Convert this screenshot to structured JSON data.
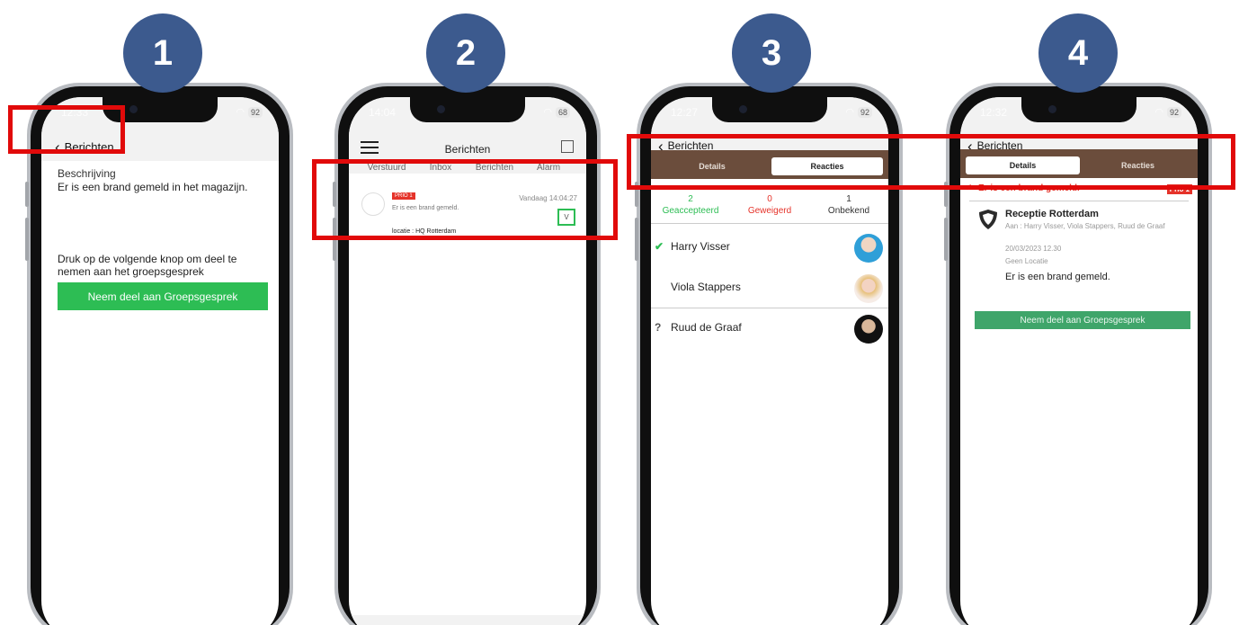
{
  "steps": [
    "1",
    "2",
    "3",
    "4"
  ],
  "colors": {
    "badge": "#3c5a8e",
    "highlight": "#e10a0a",
    "green": "#2dbd54",
    "brown": "#6b4d3c",
    "prio_red": "#e5332a"
  },
  "phone1": {
    "time": "12:33",
    "battery": "92",
    "back_label": "Berichten",
    "description_label": "Beschrijving",
    "description_text": "Er is een brand gemeld in het magazijn.",
    "prompt": "Druk op de volgende knop om deel te nemen aan het groepsgesprek",
    "join_button": "Neem deel aan Groepsgesprek"
  },
  "phone2": {
    "time": "14:04",
    "battery": "68",
    "title": "Berichten",
    "tabs": [
      "Verstuurd",
      "Inbox",
      "Berichten",
      "Alarm"
    ],
    "message": {
      "prio": "PRIO 1",
      "text": "Er is een brand gemeld.",
      "time": "Vandaag 14:04:27",
      "check": "V",
      "location": "locatie : HQ Rotterdam"
    }
  },
  "phone3": {
    "time": "12:27",
    "battery": "92",
    "back_label": "Berichten",
    "tab_details": "Details",
    "tab_reacties": "Reacties",
    "counts": [
      {
        "value": "2",
        "label": "Geaccepteerd",
        "color": "#2dbd54"
      },
      {
        "value": "0",
        "label": "Geweigerd",
        "color": "#e5332a"
      },
      {
        "value": "1",
        "label": "Onbekend",
        "color": "#333333"
      }
    ],
    "people": [
      {
        "mark": "✔",
        "name": "Harry Visser"
      },
      {
        "mark": "",
        "name": "Viola Stappers"
      },
      {
        "mark": "?",
        "name": "Ruud de Graaf"
      }
    ]
  },
  "phone4": {
    "time": "12:32",
    "battery": "92",
    "back_label": "Berichten",
    "tab_details": "Details",
    "tab_reacties": "Reacties",
    "alert_title": "Er is een brand gemeld.",
    "prio": "Prio 1",
    "sender": "Receptie Rotterdam",
    "recipients": "Aan : Harry Visser, Viola Stappers, Ruud de Graaf",
    "date": "20/03/2023 12.30",
    "location": "Geen Locatie",
    "message": "Er is een brand gemeld.",
    "join_button": "Neem deel aan Groepsgesprek"
  }
}
